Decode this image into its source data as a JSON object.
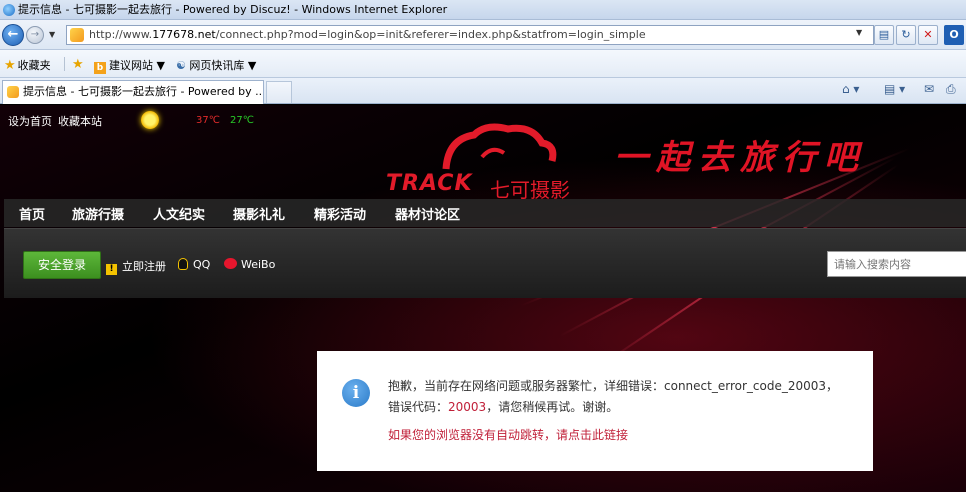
{
  "window": {
    "title": "提示信息 - 七可摄影一起去旅行 - Powered by Discuz! - Windows Internet Explorer"
  },
  "address_bar": {
    "url_prefix": "http://www.",
    "url_host": "177678.net",
    "url_path": "/connect.php?mod=login&op=init&referer=index.php&statfrom=login_simple"
  },
  "favorites_bar": {
    "favorites_label": "收藏夹",
    "suggested_sites": "建议网站 ▼",
    "web_slice": "网页快讯库 ▼"
  },
  "tabs": [
    {
      "label": "提示信息 - 七可摄影一起去旅行 - Powered by ..."
    }
  ],
  "site": {
    "top_links": [
      "设为首页",
      "收藏本站"
    ],
    "weather": {
      "icon": "sun-icon",
      "high": "37℃",
      "low": "27℃"
    },
    "logo_text": "TRACK",
    "logo_text_cn": "七可摄影",
    "slogan": "一起去旅行吧",
    "nav": [
      "首页",
      "旅游行摄",
      "人文纪实",
      "摄影礼礼",
      "精彩活动",
      "器材讨论区"
    ],
    "login_button": "安全登录",
    "register_link": "立即注册",
    "qq_link": "QQ",
    "weibo_link": "WeiBo",
    "search_placeholder": "请输入搜索内容"
  },
  "message": {
    "line1": "抱歉，当前存在网络问题或服务器繁忙，详细错误：connect_error_code_20003，",
    "line2_prefix": "错误代码：",
    "line2_code": "20003",
    "line2_suffix": "，请您稍候再试。谢谢。",
    "redirect_link": "如果您的浏览器没有自动跳转，请点击此链接"
  },
  "colors": {
    "accent_red": "#e01425",
    "login_green": "#4aa52b",
    "error_code_red": "#c01f38"
  }
}
